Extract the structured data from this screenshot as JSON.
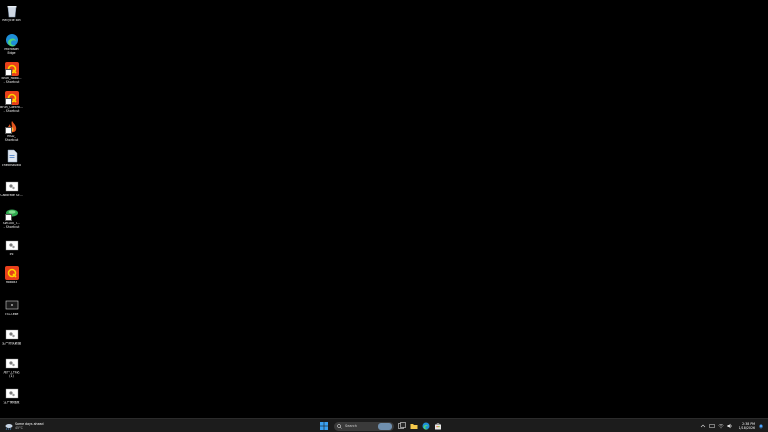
{
  "desktop": {
    "icons": [
      {
        "label": "Recycle Bin",
        "icon": "recycle-bin-icon"
      },
      {
        "label": "Microsoft\nEdge",
        "icon": "edge-icon"
      },
      {
        "label": "Brun_Robo...\n- Shortcut",
        "icon": "qt-app-icon"
      },
      {
        "label": "Brun_Contro...\n- Shortcut",
        "icon": "qt-app-icon"
      },
      {
        "label": "MSD_\nShortcut",
        "icon": "flame-app-icon"
      },
      {
        "label": "checkstudio",
        "icon": "document-icon"
      },
      {
        "label": "Calibrate Sc...",
        "icon": "settings-file-icon"
      },
      {
        "label": "SW100_T...\n- Shortcut",
        "icon": "green-app-icon"
      },
      {
        "label": "ini",
        "icon": "settings-file-icon"
      },
      {
        "label": "Robot3",
        "icon": "qt-app-icon"
      },
      {
        "label": "TSCI.exe",
        "icon": "monitor-app-icon"
      },
      {
        "label": "生产测试数据",
        "icon": "settings-file-icon"
      },
      {
        "label": "用户工作站\n(1)",
        "icon": "settings-file-icon"
      },
      {
        "label": "生产管理报",
        "icon": "settings-file-icon"
      }
    ]
  },
  "taskbar": {
    "weather": {
      "line1": "Some days ahead",
      "line2": "45°C"
    },
    "search": {
      "label": "Search"
    },
    "clock": {
      "time": "2:38 PM",
      "date": "1/18/2026"
    }
  }
}
